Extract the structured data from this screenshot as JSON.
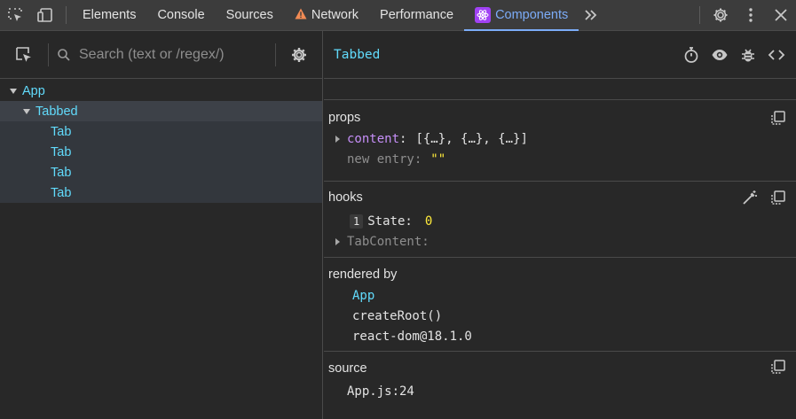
{
  "topbar": {
    "tabs": [
      {
        "label": "Elements"
      },
      {
        "label": "Console"
      },
      {
        "label": "Sources"
      },
      {
        "label": "Network"
      },
      {
        "label": "Performance"
      },
      {
        "label": "Components"
      }
    ],
    "more_label": "»",
    "active_tab": "Components"
  },
  "search": {
    "placeholder": "Search (text or /regex/)"
  },
  "tree": [
    {
      "label": "App"
    },
    {
      "label": "Tabbed"
    },
    {
      "label": "Tab"
    },
    {
      "label": "Tab"
    },
    {
      "label": "Tab"
    },
    {
      "label": "Tab"
    }
  ],
  "inspector": {
    "title": "Tabbed",
    "props": {
      "title": "props",
      "content_key": "content",
      "content_value": "[{…}, {…}, {…}]",
      "new_entry_key": "new entry",
      "new_entry_value": "\"\""
    },
    "hooks": {
      "title": "hooks",
      "state_index": "1",
      "state_key": "State",
      "state_value": "0",
      "tabcontent_key": "TabContent"
    },
    "rendered_by": {
      "title": "rendered by",
      "items": [
        "App",
        "createRoot()",
        "react-dom@18.1.0"
      ]
    },
    "source": {
      "title": "source",
      "location": "App.js:24"
    }
  },
  "colors": {
    "accent": "#7cacf8",
    "component": "#61dafb",
    "prop_key": "#c68ff8",
    "value": "#ffeb3b",
    "warning": "#f28b54"
  }
}
